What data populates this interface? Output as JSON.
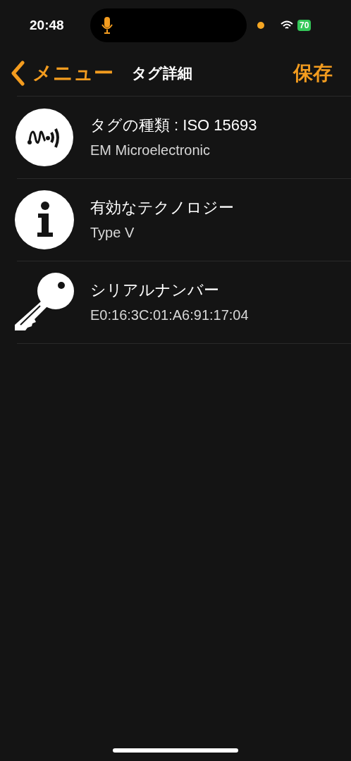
{
  "status_bar": {
    "time": "20:48",
    "battery": "70"
  },
  "nav": {
    "back": "メニュー",
    "title": "タグ詳細",
    "action": "保存"
  },
  "rows": [
    {
      "kind": "tag",
      "title": "タグの種類 : ISO 15693",
      "value": "EM Microelectronic"
    },
    {
      "kind": "info",
      "title": "有効なテクノロジー",
      "value": "Type V"
    },
    {
      "kind": "key",
      "title": "シリアルナンバー",
      "value": "E0:16:3C:01:A6:91:17:04"
    }
  ]
}
